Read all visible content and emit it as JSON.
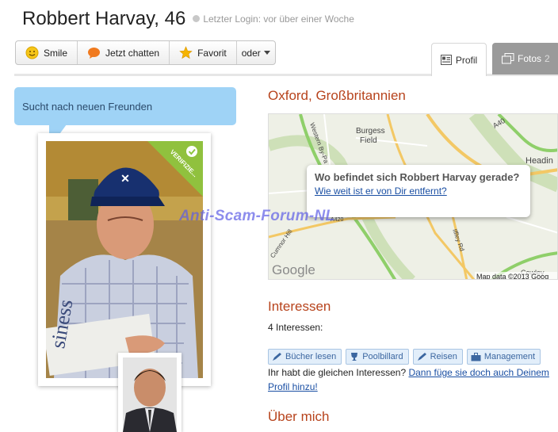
{
  "profile": {
    "name_age": "Robbert Harvay, 46",
    "last_login": "Letzter Login: vor über einer Woche"
  },
  "actions": {
    "smile": "Smile",
    "chat": "Jetzt chatten",
    "favorite": "Favorit",
    "more": "oder"
  },
  "tabs": {
    "profile": "Profil",
    "photos": "Fotos",
    "photos_count": "2"
  },
  "status_bubble": "Sucht nach neuen Freunden",
  "verified_badge": "VERIFIZIE...",
  "watermark": "Anti-Scam-Forum-NL",
  "location": {
    "title": "Oxford, Großbritannien",
    "popup_question": "Wo befindet sich Robbert Harvay gerade?",
    "popup_link": "Wie weit ist er von Dir entfernt?",
    "map_labels": [
      "Burgess",
      "Field",
      "Western By-Pa",
      "A40",
      "Headin",
      "Cumnor Hill",
      "Iffley Rd",
      "Cowley",
      "A420"
    ],
    "map_brand": "Google",
    "map_credit": "Map data ©2013 Goog"
  },
  "interests": {
    "title": "Interessen",
    "count_text": "4 Interessen:",
    "items": [
      {
        "label": "Bücher lesen",
        "icon": "pen-icon"
      },
      {
        "label": "Poolbillard",
        "icon": "trophy-icon"
      },
      {
        "label": "Reisen",
        "icon": "pen-icon"
      },
      {
        "label": "Management",
        "icon": "briefcase-icon"
      }
    ],
    "same_prefix": "Ihr habt die gleichen Interessen?",
    "same_link": "Dann füge sie doch auch Deinem Profil hinzu!"
  },
  "about": {
    "title": "Über mich"
  },
  "colors": {
    "section_title": "#b7431c",
    "link": "#1a4fa3",
    "bubble": "#9fd3f6",
    "verified": "#8dc63f"
  }
}
